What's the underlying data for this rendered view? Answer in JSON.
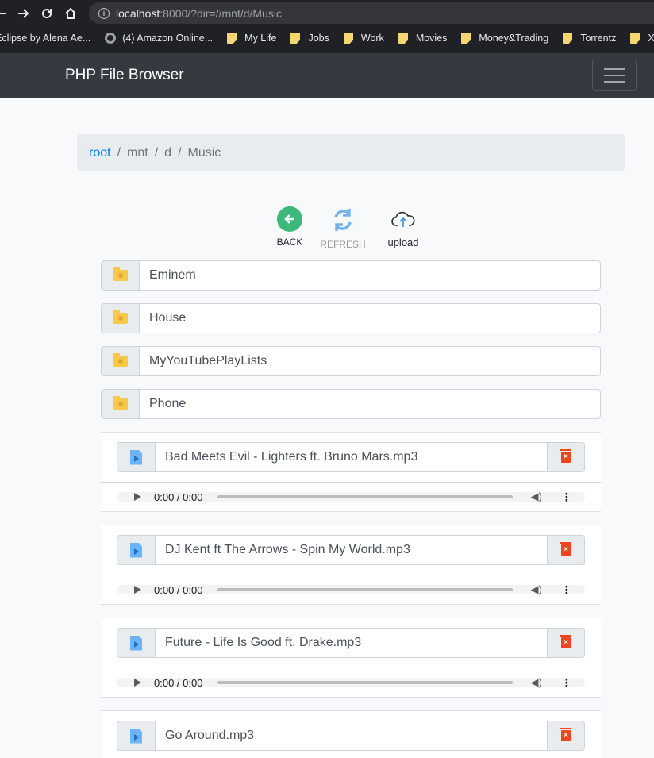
{
  "browser": {
    "url_host": "localhost",
    "url_rest": ":8000/?dir=//mnt/d/Music",
    "bookmarks": [
      {
        "label": "Eclipse by Alena Ae...",
        "icon": "none"
      },
      {
        "label": "(4) Amazon Online...",
        "icon": "globe-icon"
      },
      {
        "label": "My Life",
        "icon": "folder-icon"
      },
      {
        "label": "Jobs",
        "icon": "folder-icon"
      },
      {
        "label": "Work",
        "icon": "folder-icon"
      },
      {
        "label": "Movies",
        "icon": "folder-icon"
      },
      {
        "label": "Money&Trading",
        "icon": "folder-icon"
      },
      {
        "label": "Torrentz",
        "icon": "folder-icon"
      },
      {
        "label": "XD",
        "icon": "folder-icon"
      }
    ]
  },
  "navbar": {
    "brand": "PHP File Browser"
  },
  "breadcrumb": {
    "root": "root",
    "items": [
      "mnt",
      "d",
      "Music"
    ],
    "separator": "/"
  },
  "actions": {
    "back": "BACK",
    "refresh": "REFRESH",
    "upload": "upload"
  },
  "folders": [
    "Eminem",
    "House",
    "MyYouTubePlayLists",
    "Phone"
  ],
  "files": [
    {
      "name": "Bad Meets Evil - Lighters ft. Bruno Mars.mp3",
      "time": "0:00 / 0:00"
    },
    {
      "name": "DJ Kent ft The Arrows - Spin My World.mp3",
      "time": "0:00 / 0:00"
    },
    {
      "name": "Future - Life Is Good ft. Drake.mp3",
      "time": "0:00 / 0:00"
    },
    {
      "name": "Go Around.mp3",
      "time": ""
    }
  ],
  "colors": {
    "navbar": "#343a40",
    "link": "#007bff",
    "back": "#3cb878",
    "delete": "#f0441f",
    "folder": "#f7c948"
  }
}
